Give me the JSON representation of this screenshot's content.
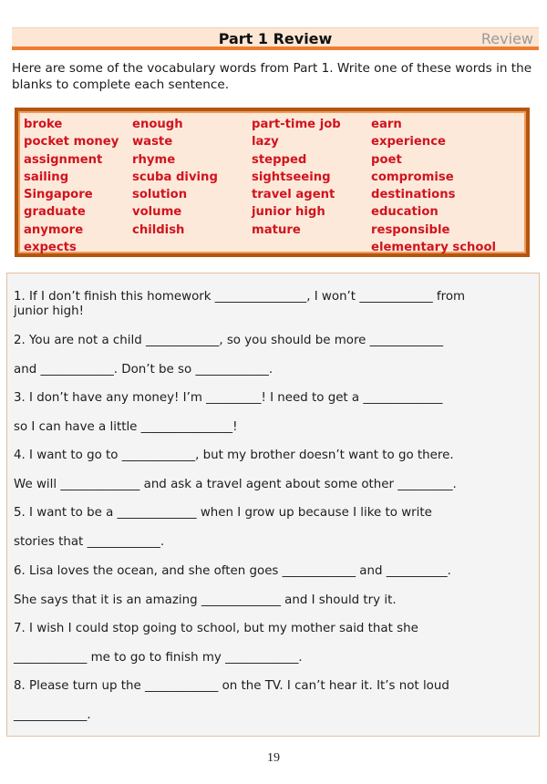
{
  "header": {
    "title": "Part 1 Review",
    "tag": "Review",
    "colors": {
      "band": "#fde6d4",
      "underline": "#ef7d2e",
      "tag_text": "#9a9a9a"
    }
  },
  "intro": "Here are some of the vocabulary words from Part 1. Write one of these words in the blanks to complete each sentence.",
  "vocabulary": {
    "colors": {
      "word": "#d0141e",
      "background": "#fde9da",
      "border": "#b3560f"
    },
    "columns": [
      [
        "broke",
        "pocket money",
        "assignment",
        "sailing",
        "Singapore",
        "graduate",
        "anymore",
        "expects"
      ],
      [
        "enough",
        "waste",
        "rhyme",
        "scuba diving",
        "solution",
        "volume",
        "childish",
        ""
      ],
      [
        "part-time job",
        "lazy",
        "stepped",
        "sightseeing",
        "travel agent",
        "junior high",
        "mature",
        ""
      ],
      [
        "earn",
        "experience",
        "poet",
        "compromise",
        "destinations",
        "education",
        "responsible",
        "elementary school"
      ]
    ]
  },
  "sentences": {
    "lines": [
      "1. If I don’t finish this homework _______________, I won’t ____________ from",
      "junior high!",
      "2. You are not a child ____________, so you should be more ____________",
      "and ____________. Don’t be so ____________.",
      "3. I don’t have any money! I’m _________! I need to get a _____________",
      "so I can have a little _______________!",
      "4. I want to go to ____________, but my brother doesn’t want to go there.",
      "We will _____________ and ask a travel agent about some other _________.",
      "5. I want to be a _____________ when I grow up because I like to write",
      "stories that ____________.",
      "6. Lisa loves the ocean, and she often goes ____________ and __________.",
      "She says that it is an amazing _____________ and I should try it.",
      "7. I wish I could stop going to school, but my mother said that she",
      "____________ me to go to finish my ____________.",
      "8. Please turn up the ____________ on the TV. I can’t hear it. It’s not loud",
      "____________."
    ]
  },
  "page_number": "19"
}
